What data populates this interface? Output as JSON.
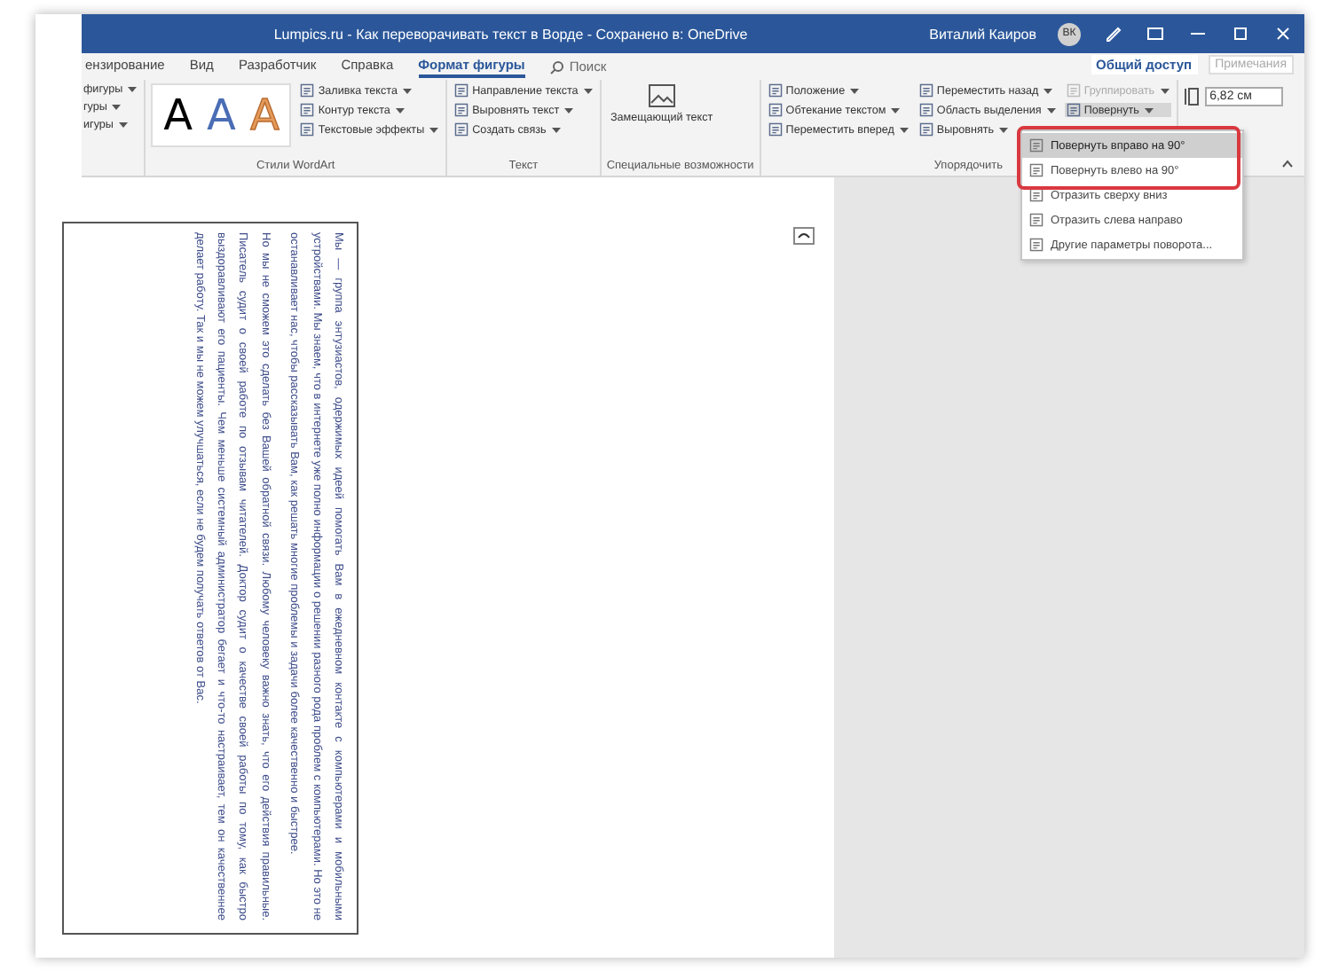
{
  "window": {
    "title": "Lumpics.ru - Как переворачивать текст в Ворде - Сохранено в: OneDrive",
    "user": "Виталий Каиров",
    "avatar": "ВК"
  },
  "tabs": [
    {
      "label": "ензирование",
      "selected": false
    },
    {
      "label": "Вид",
      "selected": false
    },
    {
      "label": "Разработчик",
      "selected": false
    },
    {
      "label": "Справка",
      "selected": false
    },
    {
      "label": "Формат фигуры",
      "selected": true
    }
  ],
  "search": {
    "placeholder": "Поиск"
  },
  "share_button": "Общий доступ",
  "comments_button": {
    "label": "Примечания",
    "disabled": true
  },
  "ribbon": {
    "cut_group": [
      {
        "label": "фигуры"
      },
      {
        "label": "гуры"
      },
      {
        "label": "игуры"
      }
    ],
    "wordart": {
      "label": "Стили WordArt",
      "styles": [
        {
          "label": "A",
          "kind": "fill",
          "color": "#000000"
        },
        {
          "label": "A",
          "kind": "fill",
          "color": "#4a6db5"
        },
        {
          "label": "A",
          "kind": "outline",
          "color": "#e39a5a"
        }
      ],
      "commands": [
        {
          "label": "Заливка текста"
        },
        {
          "label": "Контур текста"
        },
        {
          "label": "Текстовые эффекты"
        }
      ]
    },
    "text": {
      "label": "Текст",
      "commands": [
        {
          "label": "Направление текста"
        },
        {
          "label": "Выровнять текст"
        },
        {
          "label": "Создать связь"
        }
      ]
    },
    "accessibility": {
      "label": "Специальные возможности",
      "button": "Замещающий текст"
    },
    "arrange": {
      "label": "Упорядочить",
      "columns": [
        [
          {
            "label": "Положение",
            "disabled": false,
            "pressed": false
          },
          {
            "label": "Обтекание текстом",
            "disabled": false,
            "pressed": false
          },
          {
            "label": "Переместить вперед",
            "disabled": false,
            "pressed": false
          }
        ],
        [
          {
            "label": "Переместить назад",
            "disabled": false,
            "pressed": false
          },
          {
            "label": "Область выделения",
            "disabled": false,
            "pressed": false
          },
          {
            "label": "Выровнять",
            "disabled": false,
            "pressed": false
          }
        ],
        [
          {
            "label": "Группировать",
            "disabled": true,
            "pressed": false
          },
          {
            "label": "Повернуть",
            "disabled": false,
            "pressed": true
          }
        ]
      ]
    },
    "size": {
      "value": "6,82 см"
    }
  },
  "rotate_menu": [
    {
      "label": "Повернуть вправо на 90°",
      "selected": true
    },
    {
      "label": "Повернуть влево на 90°",
      "selected": false
    },
    {
      "label": "Отразить сверху вниз",
      "selected": false
    },
    {
      "label": "Отразить слева направо",
      "selected": false
    },
    {
      "label": "Другие параметры поворота...",
      "selected": false
    }
  ],
  "document": {
    "paragraphs": [
      "Мы — группа энтузиастов, одержимых идеей помогать Вам в ежедневном контакте с компьютерами и мобильными устройствами. Мы знаем, что в интернете уже полно информации о решении разного рода проблем с компьютерами. Но это не останавливает нас, чтобы рассказывать Вам, как решать многие проблемы и задачи более качественно и быстрее.",
      "Но мы не сможем это сделать без Вашей обратной связи. Любому человеку важно знать, что его действия правильные. Писатель судит о своей работе по отзывам читателей. Доктор судит о качестве своей работы по тому, как быстро выздоравливают его пациенты. Чем меньше системный администратор бегает и что-то настраивает, тем он качественнее делает работу. Так и мы не можем улучшаться, если не будем получать ответов от Вас."
    ]
  }
}
